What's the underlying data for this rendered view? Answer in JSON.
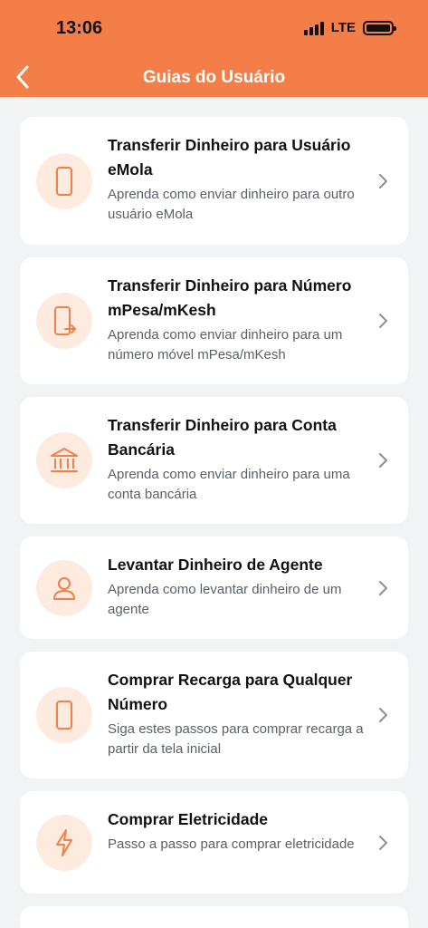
{
  "status_bar": {
    "time": "13:06",
    "network": "LTE"
  },
  "header": {
    "title": "Guias do Usuário"
  },
  "colors": {
    "accent": "#F47E48",
    "icon_bg": "#FEEBDF"
  },
  "guides": [
    {
      "title": "Transferir Dinheiro para Usuário eMola",
      "description": "Aprenda como enviar dinheiro para outro usuário eMola",
      "icon": "phone-icon"
    },
    {
      "title": "Transferir Dinheiro para Número mPesa/mKesh",
      "description": "Aprenda como enviar dinheiro para um número móvel mPesa/mKesh",
      "icon": "phone-transfer-icon"
    },
    {
      "title": "Transferir Dinheiro para Conta Bancária",
      "description": "Aprenda como enviar dinheiro para uma conta bancária",
      "icon": "bank-icon"
    },
    {
      "title": "Levantar Dinheiro de Agente",
      "description": "Aprenda como levantar dinheiro de um agente",
      "icon": "user-icon"
    },
    {
      "title": "Comprar Recarga para Qualquer Número",
      "description": "Siga estes passos para comprar recarga a partir da tela inicial",
      "icon": "phone-icon"
    },
    {
      "title": "Comprar Eletricidade",
      "description": "Passo a passo para comprar eletricidade",
      "icon": "lightning-icon"
    }
  ]
}
